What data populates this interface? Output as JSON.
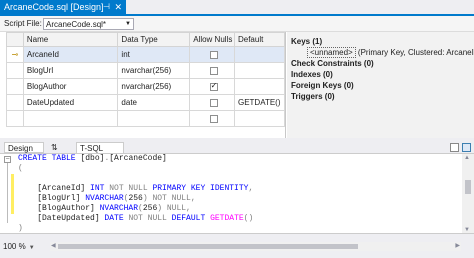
{
  "tab": {
    "title": "ArcaneCode.sql [Design]",
    "modified": "*"
  },
  "script_file": {
    "label": "Script File:",
    "value": "ArcaneCode.sql*"
  },
  "grid": {
    "headers": [
      "Name",
      "Data Type",
      "Allow Nulls",
      "Default"
    ],
    "rows": [
      {
        "name": "ArcaneId",
        "type": "int",
        "allow_nulls": false,
        "default": "",
        "key": true
      },
      {
        "name": "BlogUrl",
        "type": "nvarchar(256)",
        "allow_nulls": false,
        "default": ""
      },
      {
        "name": "BlogAuthor",
        "type": "nvarchar(256)",
        "allow_nulls": true,
        "default": ""
      },
      {
        "name": "DateUpdated",
        "type": "date",
        "allow_nulls": false,
        "default": "GETDATE()"
      },
      {
        "name": "",
        "type": "",
        "allow_nulls": false,
        "default": ""
      }
    ]
  },
  "keys_panel": {
    "keys": "Keys (1)",
    "key_item": "<unnamed>",
    "key_detail": " (Primary Key, Clustered: ArcaneId)",
    "check": "Check Constraints (0)",
    "indexes": "Indexes (0)",
    "foreign": "Foreign Keys (0)",
    "triggers": "Triggers (0)"
  },
  "pane_tabs": {
    "design": "Design",
    "swap": "⇅",
    "tsql": "T-SQL"
  },
  "editor": {
    "lines": [
      [
        [
          "kw",
          "CREATE TABLE "
        ],
        [
          "",
          "[dbo]"
        ],
        [
          "gr",
          "."
        ],
        [
          "",
          "[ArcaneCode]"
        ]
      ],
      [
        [
          "gr",
          "("
        ]
      ],
      [
        [
          "",
          ""
        ]
      ],
      [
        [
          "",
          "    [ArcaneId] "
        ],
        [
          "kw",
          "INT "
        ],
        [
          "gr",
          "NOT NULL "
        ],
        [
          "kw",
          "PRIMARY KEY IDENTITY"
        ],
        [
          "gr",
          ","
        ]
      ],
      [
        [
          "",
          "    [BlogUrl] "
        ],
        [
          "kw",
          "NVARCHAR"
        ],
        [
          "gr",
          "("
        ],
        [
          "",
          "256"
        ],
        [
          "gr",
          ") NOT NULL,"
        ]
      ],
      [
        [
          "",
          "    [BlogAuthor] "
        ],
        [
          "kw",
          "NVARCHAR"
        ],
        [
          "gr",
          "("
        ],
        [
          "",
          "256"
        ],
        [
          "gr",
          ") NULL,"
        ]
      ],
      [
        [
          "",
          "    [DateUpdated] "
        ],
        [
          "kw",
          "DATE "
        ],
        [
          "gr",
          "NOT NULL "
        ],
        [
          "kw",
          "DEFAULT "
        ],
        [
          "pk",
          "GETDATE"
        ],
        [
          "gr",
          "()"
        ]
      ],
      [
        [
          "gr",
          ")"
        ]
      ]
    ]
  },
  "status": {
    "zoom": "100 %"
  },
  "colors": {
    "accent": "#007acc",
    "keyword": "#0000ff",
    "function": "#ff00ff",
    "change_marker": "#ffee62"
  }
}
